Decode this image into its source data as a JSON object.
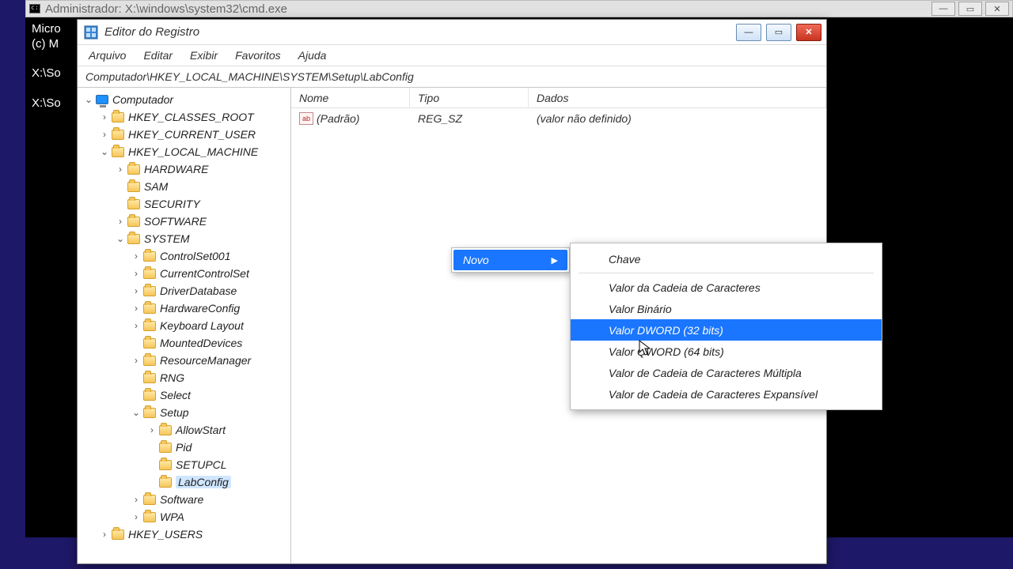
{
  "cmd": {
    "title": "Administrador: X:\\windows\\system32\\cmd.exe",
    "lines": [
      "Micro",
      "(c) M",
      "",
      "X:\\So",
      "",
      "X:\\So"
    ],
    "controls": {
      "min": "—",
      "max": "▭",
      "close": "✕"
    }
  },
  "regedit": {
    "title": "Editor do Registro",
    "controls": {
      "min": "—",
      "max": "▭",
      "close": "✕"
    },
    "menu": [
      "Arquivo",
      "Editar",
      "Exibir",
      "Favoritos",
      "Ajuda"
    ],
    "address": "Computador\\HKEY_LOCAL_MACHINE\\SYSTEM\\Setup\\LabConfig",
    "tree": [
      {
        "depth": 0,
        "arrow": "v",
        "icon": "monitor",
        "label": "Computador"
      },
      {
        "depth": 1,
        "arrow": ">",
        "icon": "folder",
        "label": "HKEY_CLASSES_ROOT"
      },
      {
        "depth": 1,
        "arrow": ">",
        "icon": "folder",
        "label": "HKEY_CURRENT_USER"
      },
      {
        "depth": 1,
        "arrow": "v",
        "icon": "folder",
        "label": "HKEY_LOCAL_MACHINE"
      },
      {
        "depth": 2,
        "arrow": ">",
        "icon": "folder",
        "label": "HARDWARE"
      },
      {
        "depth": 2,
        "arrow": "",
        "icon": "folder",
        "label": "SAM"
      },
      {
        "depth": 2,
        "arrow": "",
        "icon": "folder",
        "label": "SECURITY"
      },
      {
        "depth": 2,
        "arrow": ">",
        "icon": "folder",
        "label": "SOFTWARE"
      },
      {
        "depth": 2,
        "arrow": "v",
        "icon": "folder",
        "label": "SYSTEM"
      },
      {
        "depth": 3,
        "arrow": ">",
        "icon": "folder",
        "label": "ControlSet001"
      },
      {
        "depth": 3,
        "arrow": ">",
        "icon": "folder",
        "label": "CurrentControlSet"
      },
      {
        "depth": 3,
        "arrow": ">",
        "icon": "folder",
        "label": "DriverDatabase"
      },
      {
        "depth": 3,
        "arrow": ">",
        "icon": "folder",
        "label": "HardwareConfig"
      },
      {
        "depth": 3,
        "arrow": ">",
        "icon": "folder",
        "label": "Keyboard Layout"
      },
      {
        "depth": 3,
        "arrow": "",
        "icon": "folder",
        "label": "MountedDevices"
      },
      {
        "depth": 3,
        "arrow": ">",
        "icon": "folder",
        "label": "ResourceManager"
      },
      {
        "depth": 3,
        "arrow": "",
        "icon": "folder",
        "label": "RNG"
      },
      {
        "depth": 3,
        "arrow": "",
        "icon": "folder",
        "label": "Select"
      },
      {
        "depth": 3,
        "arrow": "v",
        "icon": "folder",
        "label": "Setup"
      },
      {
        "depth": 4,
        "arrow": ">",
        "icon": "folder",
        "label": "AllowStart"
      },
      {
        "depth": 4,
        "arrow": "",
        "icon": "folder",
        "label": "Pid"
      },
      {
        "depth": 4,
        "arrow": "",
        "icon": "folder",
        "label": "SETUPCL"
      },
      {
        "depth": 4,
        "arrow": "",
        "icon": "folder",
        "label": "LabConfig",
        "selected": true
      },
      {
        "depth": 3,
        "arrow": ">",
        "icon": "folder",
        "label": "Software"
      },
      {
        "depth": 3,
        "arrow": ">",
        "icon": "folder",
        "label": "WPA"
      },
      {
        "depth": 1,
        "arrow": ">",
        "icon": "folder",
        "label": "HKEY_USERS"
      }
    ],
    "columns": {
      "nome": "Nome",
      "tipo": "Tipo",
      "dados": "Dados"
    },
    "values": [
      {
        "icon": "ab",
        "nome": "(Padrão)",
        "tipo": "REG_SZ",
        "dados": "(valor não definido)"
      }
    ],
    "context": {
      "parent": {
        "label": "Novo"
      },
      "submenu": [
        {
          "label": "Chave"
        },
        {
          "sep": true
        },
        {
          "label": "Valor da Cadeia de Caracteres"
        },
        {
          "label": "Valor Binário"
        },
        {
          "label": "Valor DWORD (32 bits)",
          "highlight": true
        },
        {
          "label": "Valor QWORD (64 bits)"
        },
        {
          "label": "Valor de Cadeia de Caracteres Múltipla"
        },
        {
          "label": "Valor de Cadeia de Caracteres Expansível"
        }
      ]
    }
  }
}
